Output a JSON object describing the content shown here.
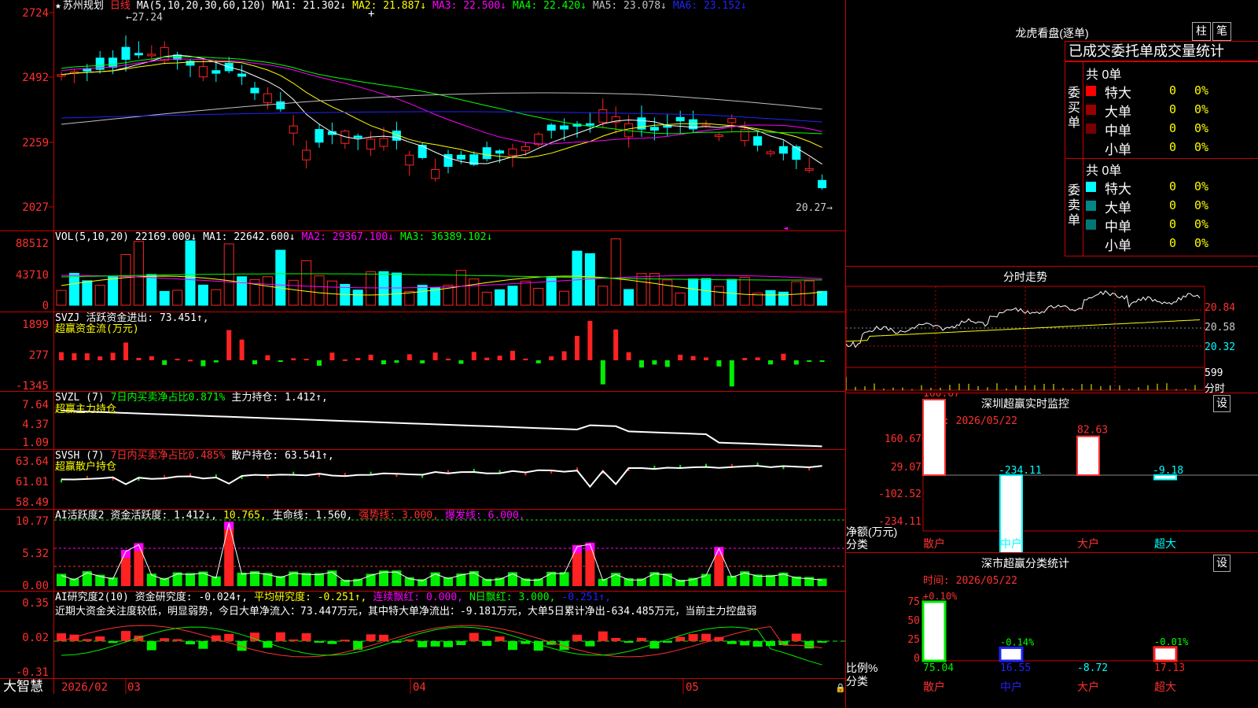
{
  "colors": {
    "up": "#ff2222",
    "down": "#00ffff",
    "axis": "#cc0000",
    "ma1": "#ffffff",
    "ma2": "#ffff00",
    "ma3": "#ff00ff",
    "ma4": "#00ff00",
    "ma5": "#c0c0c0",
    "ma6": "#2222ff",
    "green": "#00ee00",
    "magenta": "#ff00ff"
  },
  "main": {
    "stock_name": "苏州规划",
    "period": "日线",
    "ma_params": "MA(5,10,20,30,60,120)",
    "ma1": "MA1: 21.302↓",
    "ma2": "MA2: 21.887↓",
    "ma3": "MA3: 22.500↓",
    "ma4": "MA4: 22.420↓",
    "ma5": "MA5: 23.078↓",
    "ma6": "MA6: 23.152↓",
    "ticks": [
      "2724",
      "2492",
      "2259",
      "2027"
    ],
    "high_label": "27.24",
    "low_label": "20.27"
  },
  "vol": {
    "label": "VOL(5,10,20)",
    "value": "22169.000↓",
    "ma1": "MA1: 22642.600↓",
    "ma2": "MA2: 29367.100↓",
    "ma3": "MA3: 36389.102↓",
    "ticks": [
      "88512",
      "43710",
      "0"
    ]
  },
  "svzj": {
    "label": "SVZJ",
    "desc": "活跃资金进出: 73.451↑,",
    "sub": "超赢资金流(万元)",
    "ticks": [
      "1899",
      "277",
      "-1345"
    ]
  },
  "svzl": {
    "label": "SVZL (7)",
    "desc1": "7日内买卖净占比0.871%",
    "desc2": "主力持仓: 1.412↑,",
    "sub": "超赢主力持仓",
    "ticks": [
      "7.64",
      "4.37",
      "1.09"
    ]
  },
  "svsh": {
    "label": "SVSH (7)",
    "desc1": "7日内买卖净占比0.485%",
    "desc2": "散户持仓: 63.541↑,",
    "sub": "超赢散户持仓",
    "ticks": [
      "63.64",
      "61.01",
      "58.49"
    ]
  },
  "ai1": {
    "label": "AI活跃度2",
    "a": "资金活跃度: 1.412↓,",
    "b": "10.765,",
    "c": "生命线: 1.560,",
    "d": "强势线: 3.000,",
    "e": "爆发线: 6.000,",
    "ticks": [
      "10.77",
      "5.32",
      "0.00"
    ]
  },
  "ai2": {
    "label": "AI研究度2(10)",
    "a": "资金研究度: -0.024↑,",
    "b": "平均研究度: -0.251↑,",
    "c": "连续飘红: 0.000,",
    "d": "N日飘红: 3.000,",
    "e": "-0.251↑,",
    "comment": "近期大资金关注度较低，明显弱势，今日大单净流入：73.447万元，其中特大单净流出：-9.181万元，大单5日累计净出-634.485万元，当前主力控盘弱",
    "ticks": [
      "0.35",
      "0.02",
      "-0.31"
    ]
  },
  "bottom": {
    "brand": "大智慧",
    "dates": [
      "2026/02",
      "03",
      "04",
      "05"
    ]
  },
  "lhb": {
    "title": "龙虎看盘(逐单)",
    "btn1": "柱",
    "btn2": "笔",
    "head": "已成交委托单成交量统计",
    "buy_label": "委买单",
    "sell_label": "委卖单",
    "buy_total": "共 0单",
    "sell_total": "共 0单",
    "buy_rows": [
      {
        "name": "特大",
        "count": "0",
        "pct": "0%"
      },
      {
        "name": "大单",
        "count": "0",
        "pct": "0%"
      },
      {
        "name": "中单",
        "count": "0",
        "pct": "0%"
      },
      {
        "name": "小单",
        "count": "0",
        "pct": "0%"
      }
    ],
    "sell_rows": [
      {
        "name": "特大",
        "count": "0",
        "pct": "0%"
      },
      {
        "name": "大单",
        "count": "0",
        "pct": "0%"
      },
      {
        "name": "中单",
        "count": "0",
        "pct": "0%"
      },
      {
        "name": "小单",
        "count": "0",
        "pct": "0%"
      }
    ]
  },
  "fs": {
    "title": "分时走势",
    "prices": [
      "20.84",
      "20.58",
      "20.32"
    ],
    "vol": "599",
    "vol_unit": "分时"
  },
  "sz_rt": {
    "title": "深圳超赢实时监控",
    "btn": "设",
    "time": "时间: 2026/05/22",
    "ylabel1": "净额(万元)",
    "ylabel2": "分类",
    "ticks": [
      "160.67",
      "29.07",
      "-102.52",
      "-234.11"
    ],
    "cats": [
      {
        "name": "散户",
        "value": "160.67",
        "color": "#ff3030"
      },
      {
        "name": "中户",
        "value": "-234.11",
        "color": "#00ffff"
      },
      {
        "name": "大户",
        "value": "82.63",
        "color": "#ff3030"
      },
      {
        "name": "超大",
        "value": "-9.18",
        "color": "#00ffff"
      }
    ]
  },
  "sz_cls": {
    "title": "深市超赢分类统计",
    "btn": "设",
    "time": "时间: 2026/05/22",
    "ylabel1": "比例%",
    "ylabel2": "分类",
    "ticks": [
      "75",
      "50",
      "25",
      "0"
    ],
    "cats": [
      {
        "name": "散户",
        "pct": "+0.10%",
        "value": "75.04",
        "color": "#00ee00",
        "vcolor": "#00ee00"
      },
      {
        "name": "中户",
        "pct": "-0.14%",
        "value": "16.55",
        "color": "#2222ff",
        "vcolor": "#2222ff"
      },
      {
        "name": "大户",
        "pct": "",
        "value": "-8.72",
        "color": "#00ffff",
        "vcolor": "#00ffff"
      },
      {
        "name": "超大",
        "pct": "-0.01%",
        "value": "17.13",
        "color": "#ff2222",
        "vcolor": "#ff2222"
      }
    ]
  }
}
